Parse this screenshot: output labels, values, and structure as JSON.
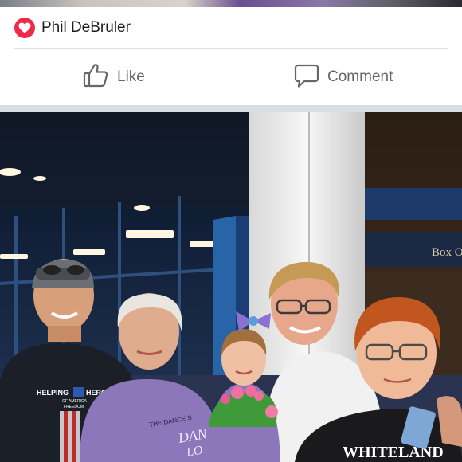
{
  "post": {
    "reaction": {
      "type": "love",
      "name": "Phil DeBruler"
    },
    "actions": {
      "like_label": "Like",
      "comment_label": "Comment"
    },
    "photo": {
      "sign_text": "Box O",
      "shirt_left_line1": "HELPING",
      "shirt_left_line2": "HEROES",
      "shirt_left_line3": "OF AMERICA",
      "shirt_left_line4": "FREEDOM",
      "shirt_middle_line1": "THE DANCE S",
      "shirt_middle_line2": "DAN",
      "shirt_middle_line3": "LO",
      "shirt_right": "WHITELAND"
    }
  },
  "colors": {
    "love_red": "#f0284a",
    "action_gray": "#65676b",
    "separator_gray": "#dadde1"
  }
}
